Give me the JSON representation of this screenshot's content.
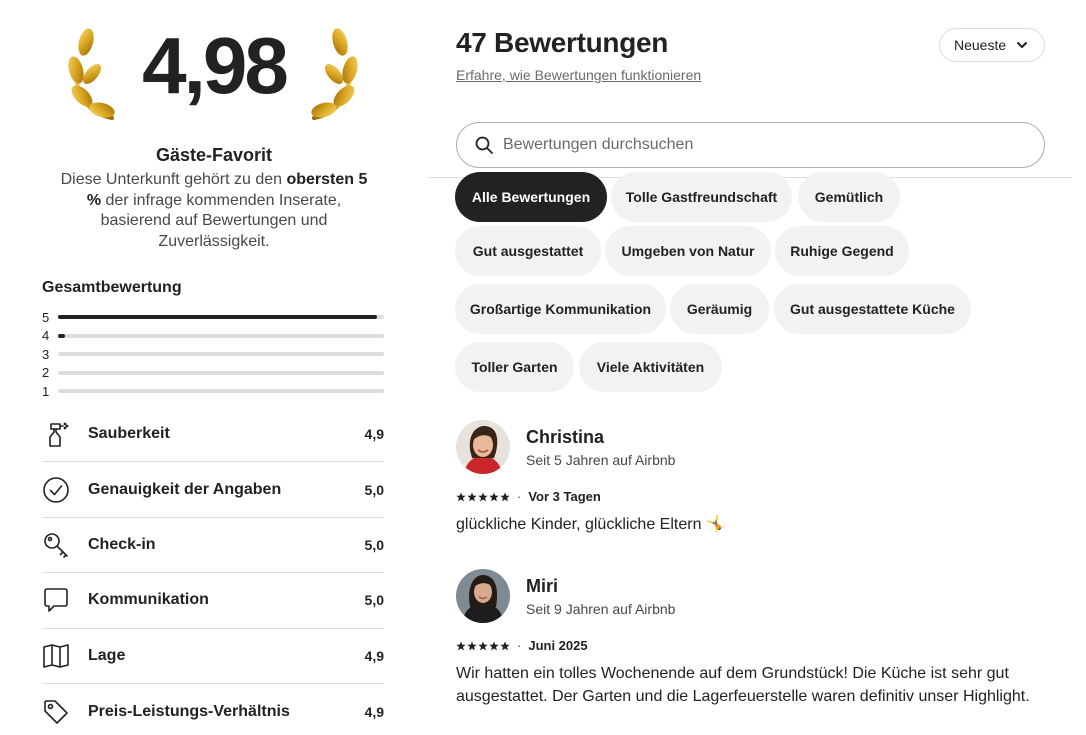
{
  "summary": {
    "rating": "4,98",
    "badge_title": "Gäste-Favorit",
    "desc_part1": "Diese Unterkunft gehört zu den ",
    "desc_bold": "obersten 5 %",
    "desc_part2": " der infrage kommenden Inserate, basierend auf Bewertungen und Zuverlässigkeit."
  },
  "overall": {
    "title": "Gesamtbewertung",
    "distribution": [
      {
        "stars": "5",
        "fraction": 0.98
      },
      {
        "stars": "4",
        "fraction": 0.02
      },
      {
        "stars": "3",
        "fraction": 0.0
      },
      {
        "stars": "2",
        "fraction": 0.0
      },
      {
        "stars": "1",
        "fraction": 0.0
      }
    ]
  },
  "categories": [
    {
      "label": "Sauberkeit",
      "value": "4,9",
      "icon": "spray-bottle-icon"
    },
    {
      "label": "Genauigkeit der Angaben",
      "value": "5,0",
      "icon": "check-circle-icon"
    },
    {
      "label": "Check-in",
      "value": "5,0",
      "icon": "key-icon"
    },
    {
      "label": "Kommunikation",
      "value": "5,0",
      "icon": "chat-bubble-icon"
    },
    {
      "label": "Lage",
      "value": "4,9",
      "icon": "map-icon"
    },
    {
      "label": "Preis-Leistungs-Verhältnis",
      "value": "4,9",
      "icon": "price-tag-icon"
    }
  ],
  "reviews_header": {
    "count_title": "47 Bewertungen",
    "how_link": "Erfahre, wie Bewertungen funktionieren",
    "sort_label": "Neueste"
  },
  "search": {
    "placeholder": "Bewertungen durchsuchen"
  },
  "chips": [
    "Alle Bewertungen",
    "Tolle Gastfreundschaft",
    "Gemütlich",
    "Gut ausgestattet",
    "Umgeben von Natur",
    "Ruhige Gegend",
    "Großartige Kommunikation",
    "Geräumig",
    "Gut ausgestattete Küche",
    "Toller Garten",
    "Viele Aktivitäten"
  ],
  "reviews": [
    {
      "name": "Christina",
      "member_since": "Seit 5 Jahren auf Airbnb",
      "rating": 5,
      "date": "Vor 3 Tagen",
      "text": "glückliche Kinder,  glückliche Eltern 🤸"
    },
    {
      "name": "Miri",
      "member_since": "Seit 9 Jahren auf Airbnb",
      "rating": 5,
      "date": "Juni 2025",
      "text": "Wir hatten ein tolles Wochenende auf dem Grundstück! Die Küche ist sehr gut ausgestattet. Der Garten und die Lagerfeuerstelle waren definitiv unser Highlight."
    }
  ],
  "colors": {
    "text": "#222222",
    "muted": "#6a6a6a",
    "chip_bg": "#f2f2f2",
    "chip_active_bg": "#222222",
    "divider": "#dddddd",
    "gold": "#d9a520"
  }
}
